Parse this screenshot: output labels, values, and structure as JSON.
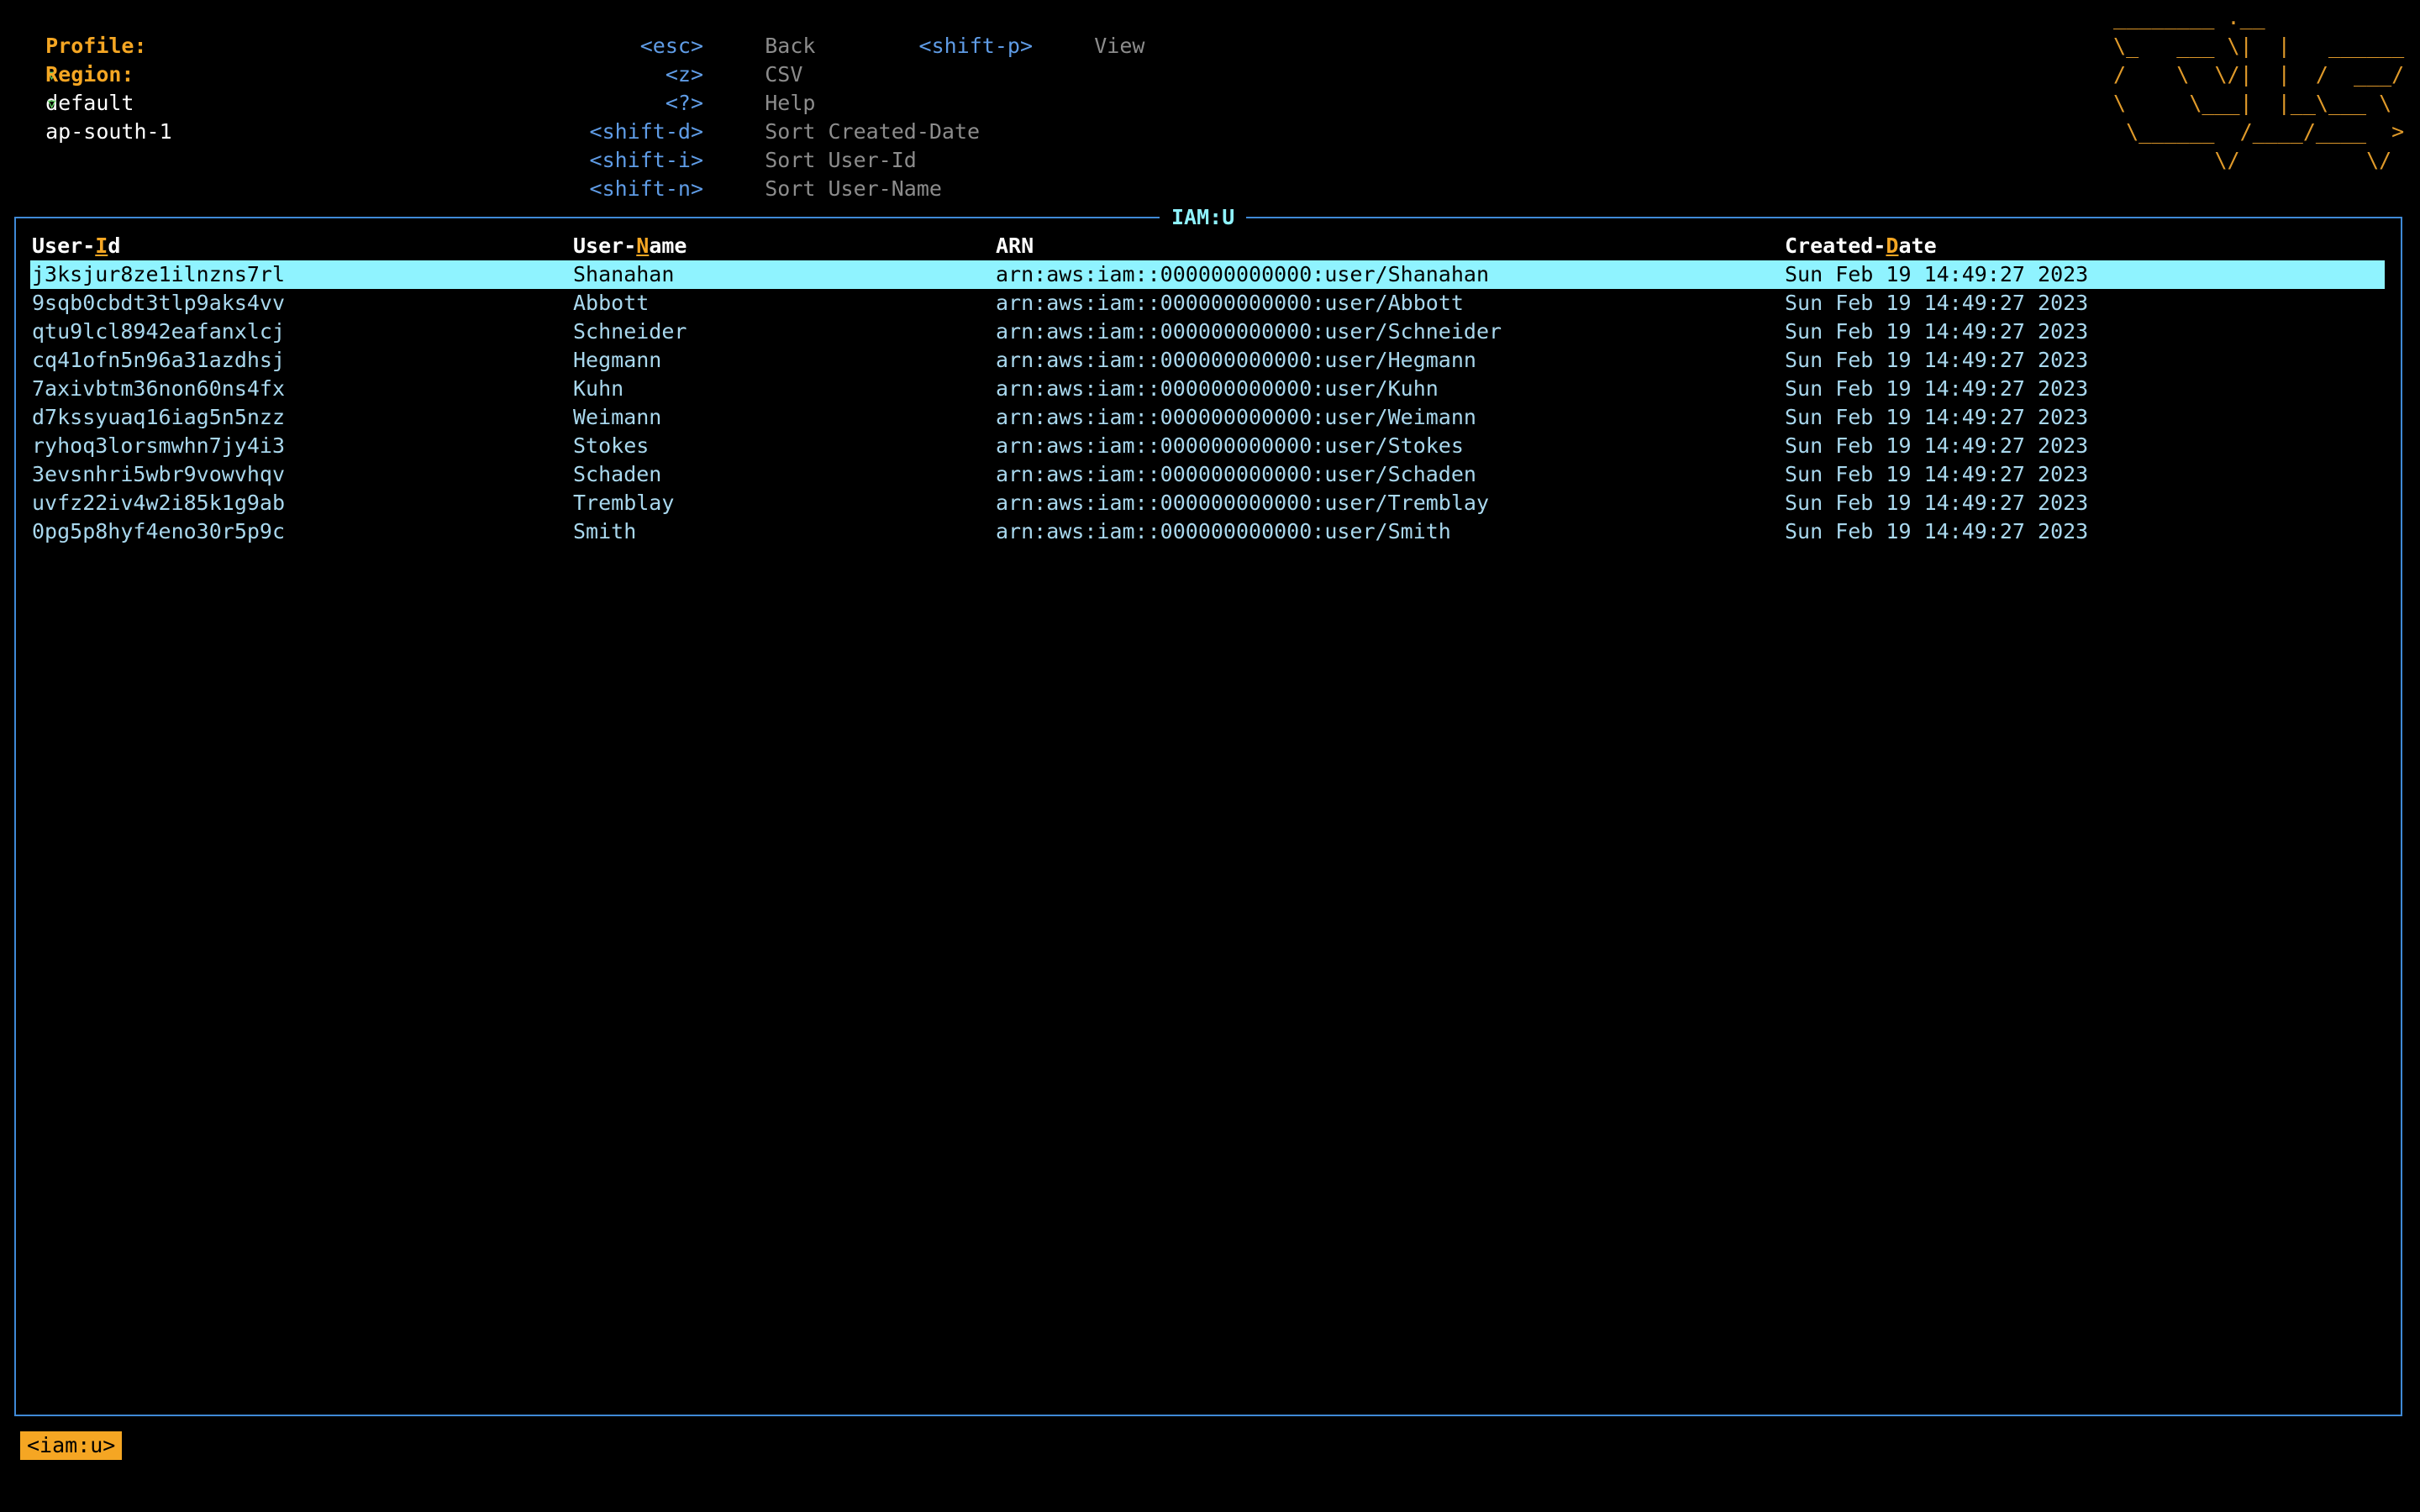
{
  "context": {
    "profile_label": "Profile:",
    "profile_caret": "▿",
    "profile_value": "default",
    "region_label": "Region:",
    "region_caret": "▿",
    "region_value": "ap-south-1"
  },
  "shortcuts": {
    "col1": [
      {
        "key": "<esc>",
        "desc": "Back"
      },
      {
        "key": "<z>",
        "desc": "CSV"
      },
      {
        "key": "<?>",
        "desc": "Help"
      },
      {
        "key": "<shift-d>",
        "desc": "Sort Created-Date"
      },
      {
        "key": "<shift-i>",
        "desc": "Sort User-Id"
      },
      {
        "key": "<shift-n>",
        "desc": "Sort User-Name"
      }
    ],
    "col2": [
      {
        "key": "<shift-p>",
        "desc": "View"
      }
    ]
  },
  "logo_art": " ________ .__\n \\_   ___ \\|  |   ______\n /    \\  \\/|  |  /  ___/\n \\     \\___|  |__\\___ \\\n  \\______  /____/____  >\n         \\/          \\/",
  "table": {
    "title": "IAM:U",
    "headers": {
      "id": {
        "pre": "User-",
        "hot": "I",
        "post": "d"
      },
      "name": {
        "pre": "User-",
        "hot": "N",
        "post": "ame"
      },
      "arn": {
        "pre": "ARN",
        "hot": "",
        "post": ""
      },
      "date": {
        "pre": "Created-",
        "hot": "D",
        "post": "ate"
      }
    },
    "selected_index": 0,
    "rows": [
      {
        "id": "j3ksjur8ze1ilnzns7rl",
        "name": "Shanahan",
        "arn": "arn:aws:iam::000000000000:user/Shanahan",
        "date": "Sun Feb 19 14:49:27 2023"
      },
      {
        "id": "9sqb0cbdt3tlp9aks4vv",
        "name": "Abbott",
        "arn": "arn:aws:iam::000000000000:user/Abbott",
        "date": "Sun Feb 19 14:49:27 2023"
      },
      {
        "id": "qtu9lcl8942eafanxlcj",
        "name": "Schneider",
        "arn": "arn:aws:iam::000000000000:user/Schneider",
        "date": "Sun Feb 19 14:49:27 2023"
      },
      {
        "id": "cq41ofn5n96a31azdhsj",
        "name": "Hegmann",
        "arn": "arn:aws:iam::000000000000:user/Hegmann",
        "date": "Sun Feb 19 14:49:27 2023"
      },
      {
        "id": "7axivbtm36non60ns4fx",
        "name": "Kuhn",
        "arn": "arn:aws:iam::000000000000:user/Kuhn",
        "date": "Sun Feb 19 14:49:27 2023"
      },
      {
        "id": "d7kssyuaq16iag5n5nzz",
        "name": "Weimann",
        "arn": "arn:aws:iam::000000000000:user/Weimann",
        "date": "Sun Feb 19 14:49:27 2023"
      },
      {
        "id": "ryhoq3lorsmwhn7jy4i3",
        "name": "Stokes",
        "arn": "arn:aws:iam::000000000000:user/Stokes",
        "date": "Sun Feb 19 14:49:27 2023"
      },
      {
        "id": "3evsnhri5wbr9vowvhqv",
        "name": "Schaden",
        "arn": "arn:aws:iam::000000000000:user/Schaden",
        "date": "Sun Feb 19 14:49:27 2023"
      },
      {
        "id": "uvfz22iv4w2i85k1g9ab",
        "name": "Tremblay",
        "arn": "arn:aws:iam::000000000000:user/Tremblay",
        "date": "Sun Feb 19 14:49:27 2023"
      },
      {
        "id": "0pg5p8hyf4eno30r5p9c",
        "name": "Smith",
        "arn": "arn:aws:iam::000000000000:user/Smith",
        "date": "Sun Feb 19 14:49:27 2023"
      }
    ]
  },
  "breadcrumb": "<iam:u>",
  "colors": {
    "background": "#000000",
    "accent_orange": "#f5a623",
    "key_blue": "#5f9ce6",
    "frame_blue": "#3f89d6",
    "selected_bg": "#8ff3ff",
    "row_text": "#a9d8ee",
    "caret_green": "#62d262"
  }
}
